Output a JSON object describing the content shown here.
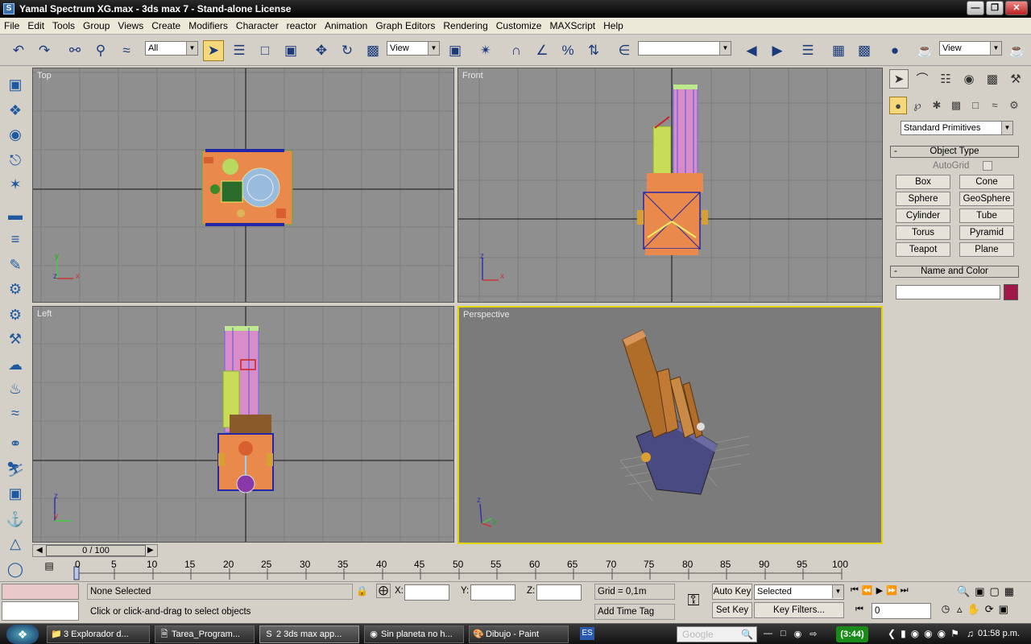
{
  "window": {
    "title": "Yamal Spectrum XG.max - 3ds max 7  - Stand-alone License",
    "app_icon": "S"
  },
  "menu": [
    "File",
    "Edit",
    "Tools",
    "Group",
    "Views",
    "Create",
    "Modifiers",
    "Character",
    "reactor",
    "Animation",
    "Graph Editors",
    "Rendering",
    "Customize",
    "MAXScript",
    "Help"
  ],
  "toolbar": {
    "selection_filter": "All",
    "ref_coord": "View",
    "render_view": "View",
    "named_sel": ""
  },
  "viewports": {
    "top": "Top",
    "front": "Front",
    "left": "Left",
    "perspective": "Perspective"
  },
  "axes": {
    "x": "x",
    "y": "y",
    "z": "z"
  },
  "command_panel": {
    "category": "Standard Primitives",
    "object_type_title": "Object Type",
    "autogrid_label": "AutoGrid",
    "primitives": [
      "Box",
      "Cone",
      "Sphere",
      "GeoSphere",
      "Cylinder",
      "Tube",
      "Torus",
      "Pyramid",
      "Teapot",
      "Plane"
    ],
    "name_color_title": "Name and Color",
    "object_color": "#a01848"
  },
  "time": {
    "slider": "0 / 100",
    "ticks": [
      "0",
      "5",
      "10",
      "15",
      "20",
      "25",
      "30",
      "35",
      "40",
      "45",
      "50",
      "55",
      "60",
      "65",
      "70",
      "75",
      "80",
      "85",
      "90",
      "95",
      "100"
    ]
  },
  "status": {
    "selection": "None Selected",
    "prompt": "Click or click-and-drag to select objects",
    "x_label": "X:",
    "y_label": "Y:",
    "z_label": "Z:",
    "grid": "Grid = 0,1m",
    "add_time_tag": "Add Time Tag",
    "auto_key": "Auto Key",
    "set_key": "Set Key",
    "key_mode": "Selected",
    "key_filters": "Key Filters...",
    "frame": "0"
  },
  "taskbar": {
    "tasks": [
      "3 Explorador d...",
      "Tarea_Program...",
      "2 3ds max app...",
      "Sin planeta no h...",
      "Dibujo - Paint"
    ],
    "lang": "ES",
    "search": "Google",
    "timer": "(3:44)",
    "clock": "01:58 p.m."
  }
}
